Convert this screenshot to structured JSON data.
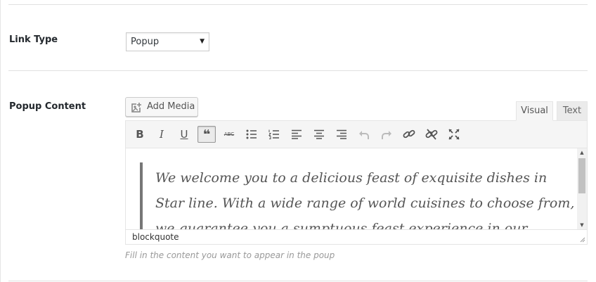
{
  "rows": {
    "link_type": {
      "label": "Link Type",
      "select_value": "Popup",
      "arrow_glyph": "▼"
    },
    "popup_content": {
      "label": "Popup Content",
      "add_media_label": "Add Media",
      "tabs": [
        {
          "label": "Visual",
          "active": true
        },
        {
          "label": "Text",
          "active": false
        }
      ],
      "toolbar": [
        {
          "name": "bold-icon",
          "glyph": "B"
        },
        {
          "name": "italic-icon",
          "glyph": "I"
        },
        {
          "name": "underline-icon",
          "glyph": "U"
        },
        {
          "name": "blockquote-icon",
          "glyph": "❝",
          "active": true
        },
        {
          "name": "strikethrough-icon",
          "glyph": "ABC"
        },
        {
          "name": "bulleted-list-icon"
        },
        {
          "name": "numbered-list-icon"
        },
        {
          "name": "align-left-icon"
        },
        {
          "name": "align-center-icon"
        },
        {
          "name": "align-right-icon"
        },
        {
          "name": "undo-icon",
          "disabled": true
        },
        {
          "name": "redo-icon",
          "disabled": true
        },
        {
          "name": "insert-link-icon"
        },
        {
          "name": "remove-link-icon"
        },
        {
          "name": "fullscreen-icon"
        }
      ],
      "content": "We welcome you to a delicious feast of exquisite dishes in Star line. With a wide range of world cuisines to choose from, we guarantee you a sumptuous feast experience in our",
      "status_path": "blockquote",
      "help_text": "Fill in the content you want to appear in the poup"
    }
  },
  "colors": {
    "active_button_border": "#999999",
    "quote_border": "#777777",
    "help_text": "#999999"
  }
}
